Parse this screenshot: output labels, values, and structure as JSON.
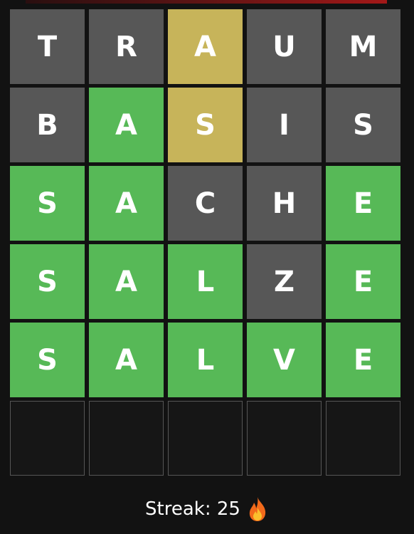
{
  "colors": {
    "background": "#121212",
    "absent": "#575757",
    "correct": "#57b957",
    "present": "#c7b45a",
    "empty": "#161616"
  },
  "board": {
    "rows": [
      {
        "tiles": [
          {
            "letter": "T",
            "state": "absent"
          },
          {
            "letter": "R",
            "state": "absent"
          },
          {
            "letter": "A",
            "state": "present"
          },
          {
            "letter": "U",
            "state": "absent"
          },
          {
            "letter": "M",
            "state": "absent"
          }
        ]
      },
      {
        "tiles": [
          {
            "letter": "B",
            "state": "absent"
          },
          {
            "letter": "A",
            "state": "correct"
          },
          {
            "letter": "S",
            "state": "present"
          },
          {
            "letter": "I",
            "state": "absent"
          },
          {
            "letter": "S",
            "state": "absent"
          }
        ]
      },
      {
        "tiles": [
          {
            "letter": "S",
            "state": "correct"
          },
          {
            "letter": "A",
            "state": "correct"
          },
          {
            "letter": "C",
            "state": "absent"
          },
          {
            "letter": "H",
            "state": "absent"
          },
          {
            "letter": "E",
            "state": "correct"
          }
        ]
      },
      {
        "tiles": [
          {
            "letter": "S",
            "state": "correct"
          },
          {
            "letter": "A",
            "state": "correct"
          },
          {
            "letter": "L",
            "state": "correct"
          },
          {
            "letter": "Z",
            "state": "absent"
          },
          {
            "letter": "E",
            "state": "correct"
          }
        ]
      },
      {
        "tiles": [
          {
            "letter": "S",
            "state": "correct"
          },
          {
            "letter": "A",
            "state": "correct"
          },
          {
            "letter": "L",
            "state": "correct"
          },
          {
            "letter": "V",
            "state": "correct"
          },
          {
            "letter": "E",
            "state": "correct"
          }
        ]
      },
      {
        "tiles": [
          {
            "letter": "",
            "state": "empty"
          },
          {
            "letter": "",
            "state": "empty"
          },
          {
            "letter": "",
            "state": "empty"
          },
          {
            "letter": "",
            "state": "empty"
          },
          {
            "letter": "",
            "state": "empty"
          }
        ]
      }
    ]
  },
  "streak": {
    "label": "Streak: 25",
    "icon": "fire-icon"
  }
}
